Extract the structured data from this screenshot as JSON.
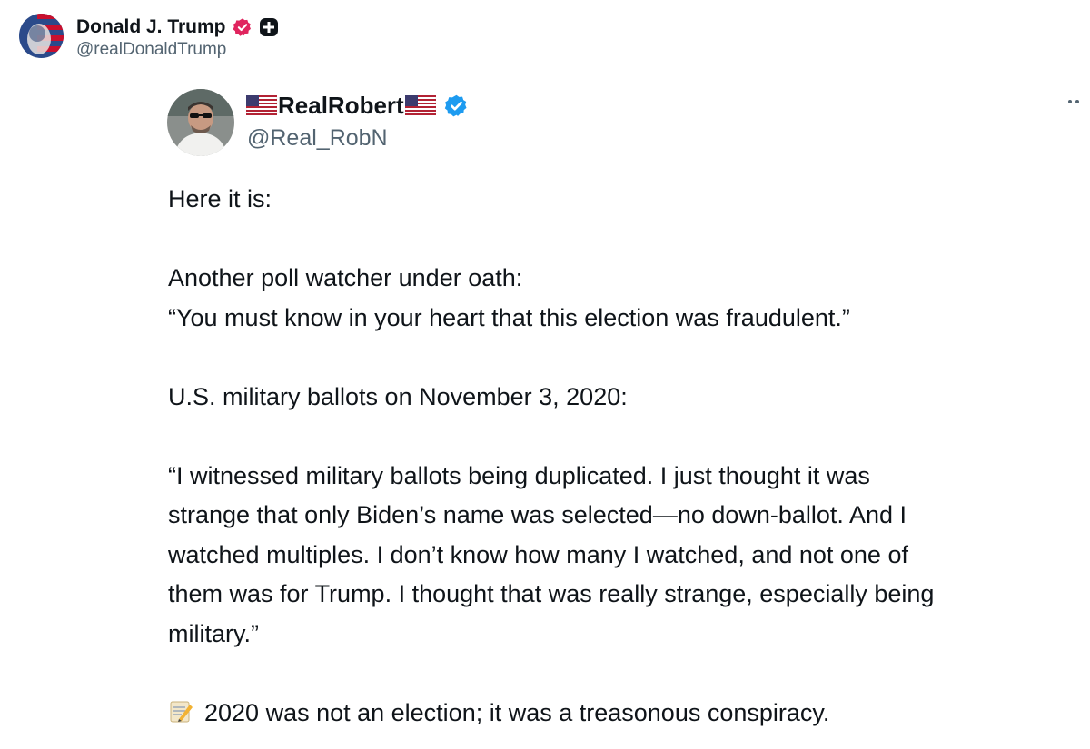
{
  "outer_post": {
    "display_name": "Donald J. Trump",
    "handle": "@realDonaldTrump",
    "verified_icon": "verified-badge-icon",
    "verified_color": "#e0245e",
    "extra_badge_icon": "plus-badge-icon"
  },
  "quoted_post": {
    "display_name": "RealRobert",
    "handle": "@Real_RobN",
    "verified_color": "#1d9bf0",
    "flag_icon": "us-flag-icon",
    "more_icon": "more-options-icon",
    "lines": [
      "Here it is:",
      "",
      "Another poll watcher under oath:",
      "“You must know in your heart that this election was fraudulent.”",
      "",
      "U.S. military ballots on November 3, 2020:",
      "",
      "“I witnessed military ballots being duplicated. I just thought it was",
      "strange that only Biden’s name was selected—no down-ballot. And I",
      "watched multiples. I don’t know how many I watched, and not one of",
      "them was for Trump. I thought that was really strange, especially being",
      "military.”",
      ""
    ],
    "final_line_icon": "memo-icon",
    "final_line": "2020 was not an election; it was a treasonous conspiracy."
  }
}
